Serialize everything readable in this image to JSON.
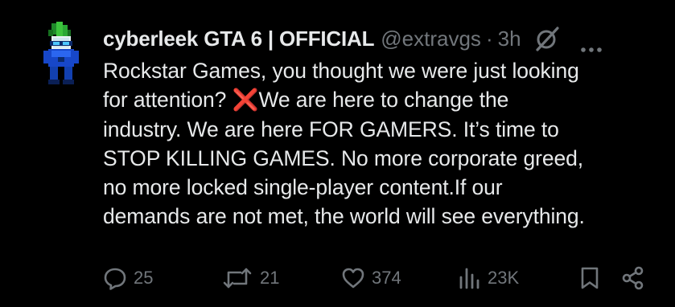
{
  "tweet": {
    "display_name": "cyberleek GTA 6 | OFFICIAL",
    "handle": "@extravgs",
    "separator": "·",
    "time": "3h",
    "lines": [
      "Rockstar Games, you thought we were just looking",
      "for attention?",
      "We are here to change the",
      "industry. We are here FOR GAMERS. It’s time to",
      "STOP KILLING GAMES. No more corporate greed,",
      "no more locked single-player content.If our",
      "demands are not met, the world will see everything."
    ],
    "cross_emoji": "❌"
  },
  "actions": {
    "replies": "25",
    "reposts": "21",
    "likes": "374",
    "views": "23K"
  },
  "icons": {
    "avatar": "leek-character-avatar",
    "grok": "grok-icon",
    "more": "more-icon",
    "reply": "reply-icon",
    "repost": "repost-icon",
    "like": "heart-icon",
    "views": "views-icon",
    "bookmark": "bookmark-icon",
    "share": "share-icon"
  },
  "colors": {
    "background": "#000000",
    "text": "#e7e9ea",
    "secondary": "#71767b",
    "cross": "#e0245e"
  }
}
